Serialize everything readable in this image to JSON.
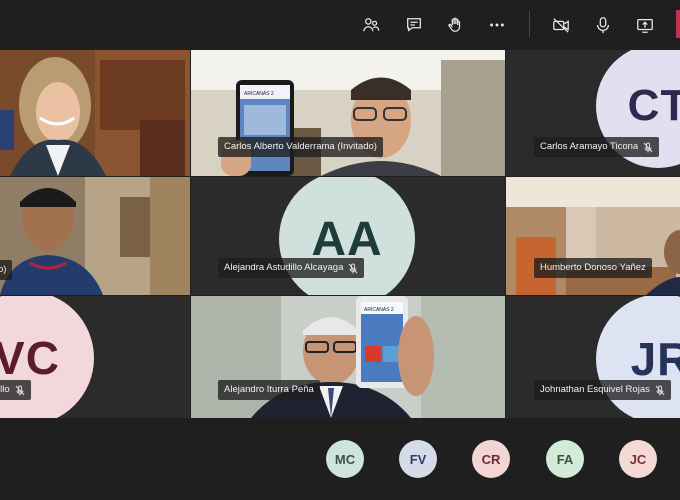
{
  "toolbar": {
    "buttons": [
      "participants",
      "chat",
      "raise-hand",
      "more-actions",
      "camera-off",
      "microphone",
      "share-screen"
    ]
  },
  "tiles": {
    "t1": {
      "name": ""
    },
    "t2": {
      "name": "Carlos Alberto Valderrama (Invitado)"
    },
    "t3": {
      "name": "Carlos Aramayo Ticona",
      "initials": "CT"
    },
    "t4": {
      "name": "o)"
    },
    "t5": {
      "name": "Alejandra Astudillo Alcayaga",
      "initials": "AA"
    },
    "t6": {
      "name": "Humberto Donoso Yañez"
    },
    "t7": {
      "name": "illo",
      "initials": "VC"
    },
    "t8": {
      "name": "Alejandro Iturra Peña"
    },
    "t9": {
      "name": "Johnathan Esquivel Rojas",
      "initials": "JR"
    }
  },
  "phone_screens": {
    "t2": {
      "text": "ARICANAS 2"
    },
    "t8": {
      "text": "ARICANAS 2"
    }
  },
  "bottom_participants": [
    {
      "initials": "MC",
      "bg": "#cfe3df",
      "fg": "#36524a"
    },
    {
      "initials": "FV",
      "bg": "#d6dbea",
      "fg": "#333d63"
    },
    {
      "initials": "CR",
      "bg": "#f3d5d6",
      "fg": "#6b2b33"
    },
    {
      "initials": "FA",
      "bg": "#d4ead9",
      "fg": "#2d5a3a"
    },
    {
      "initials": "JC",
      "bg": "#f5d9d6",
      "fg": "#6f3730"
    }
  ],
  "colors": {
    "toolbar_bg": "#1f1f1f",
    "tile_bg": "#292929",
    "leave_red": "#c4314b",
    "ct_bg": "#e1dff0",
    "ct_fg": "#2c2a4e",
    "aa_bg": "#cfe0dd",
    "aa_fg": "#1e3d3a",
    "vc_bg": "#f2d8dc",
    "vc_fg": "#5b1d2b",
    "jr_bg": "#dde3f3",
    "jr_fg": "#263257"
  }
}
